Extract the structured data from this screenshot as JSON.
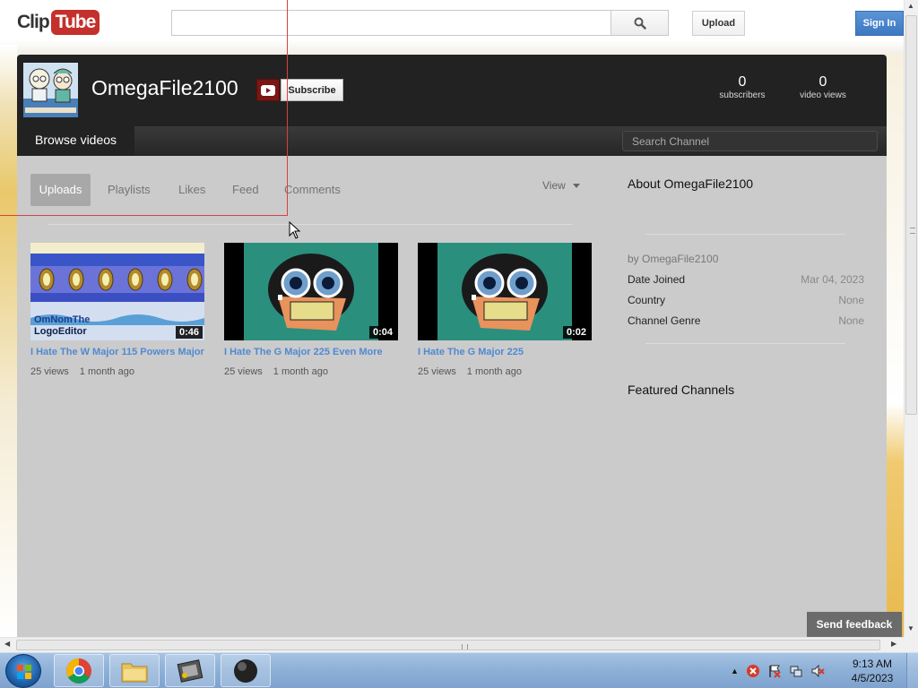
{
  "header": {
    "logo_clip": "Clip",
    "logo_tube": "Tube",
    "search_placeholder": "",
    "upload_label": "Upload",
    "signin_label": "Sign In"
  },
  "channel": {
    "name": "OmegaFile2100",
    "subscribe_label": "Subscribe",
    "subscribers_count": "0",
    "subscribers_label": "subscribers",
    "views_count": "0",
    "views_label": "video views",
    "browse_tab": "Browse videos",
    "search_placeholder": "Search Channel"
  },
  "tabs": {
    "uploads": "Uploads",
    "playlists": "Playlists",
    "likes": "Likes",
    "feed": "Feed",
    "comments": "Comments",
    "view": "View"
  },
  "videos": [
    {
      "title": "I Hate The W Major 115 Powers Major",
      "duration": "0:46",
      "views": "25 views",
      "age": "1 month ago",
      "thumb_text_1": "OmNomThe",
      "thumb_text_2": "LogoEditor"
    },
    {
      "title": "I Hate The G Major 225 Even More",
      "duration": "0:04",
      "views": "25 views",
      "age": "1 month ago"
    },
    {
      "title": "I Hate The G Major 225",
      "duration": "0:02",
      "views": "25 views",
      "age": "1 month ago"
    }
  ],
  "about": {
    "title": "About OmegaFile2100",
    "by": "by OmegaFile2100",
    "rows": [
      {
        "label": "Date Joined",
        "value": "Mar 04, 2023"
      },
      {
        "label": "Country",
        "value": "None"
      },
      {
        "label": "Channel Genre",
        "value": "None"
      }
    ],
    "featured_title": "Featured Channels"
  },
  "feedback_label": "Send feedback",
  "taskbar": {
    "time": "9:13 AM",
    "date": "4/5/2023"
  },
  "colors": {
    "brand_red": "#c4302b",
    "link_blue": "#4f8ad2",
    "header_dark": "#222222",
    "content_gray": "#cbcbcb"
  }
}
